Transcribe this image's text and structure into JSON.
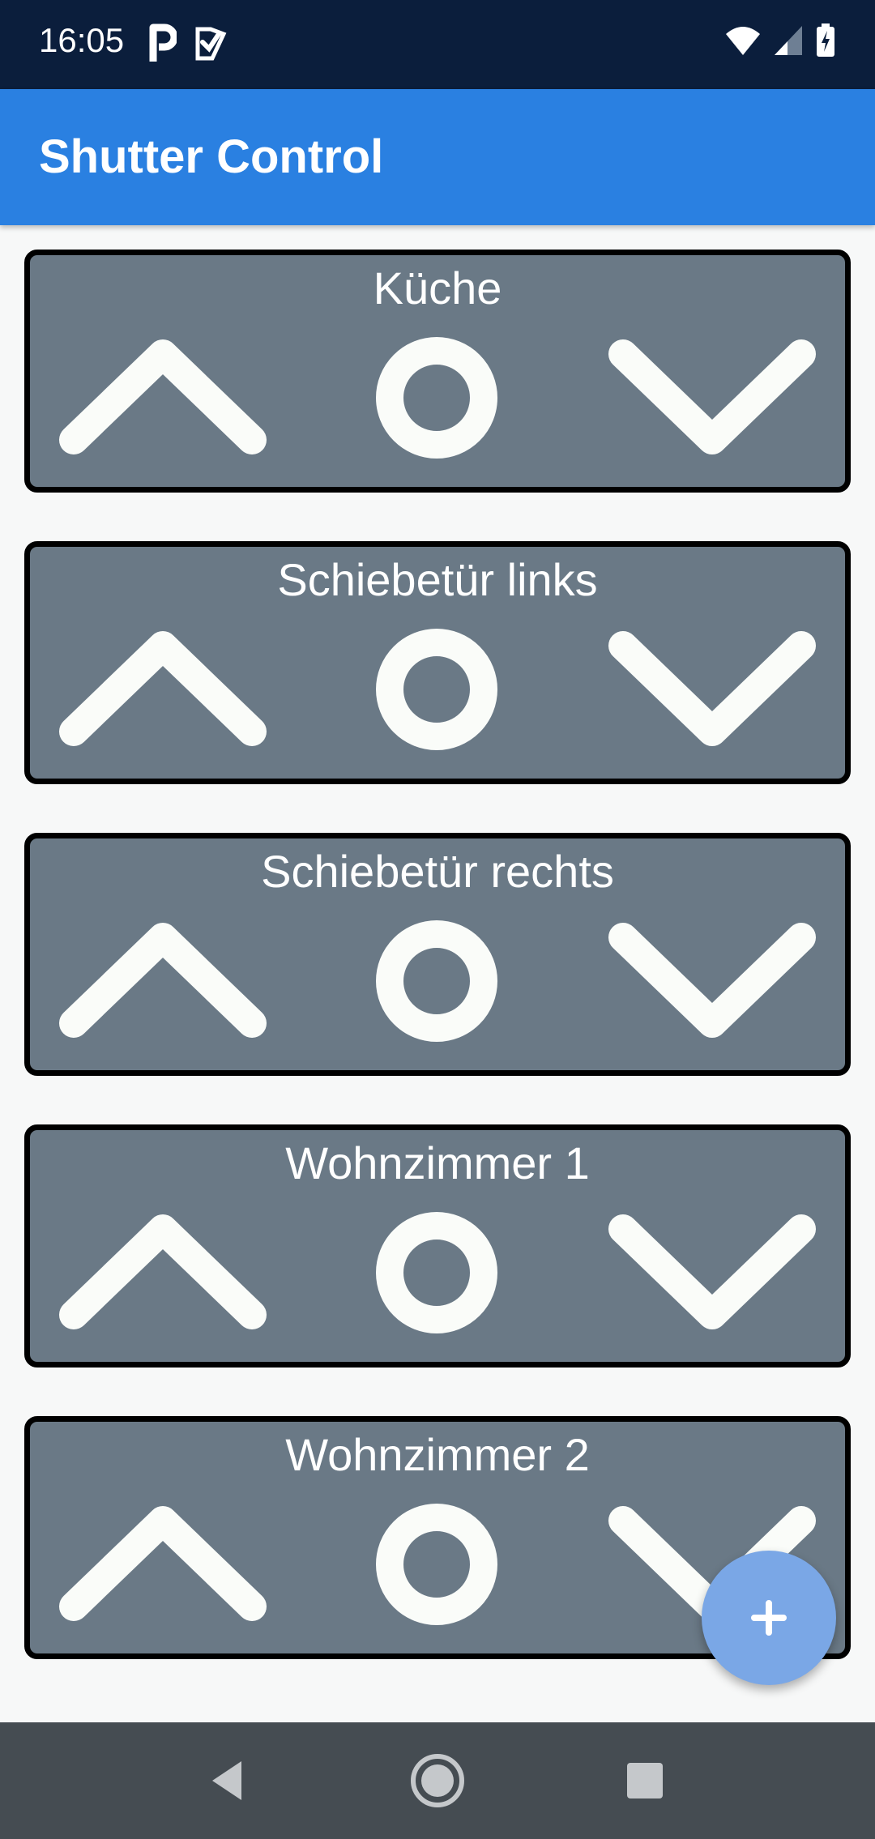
{
  "status_bar": {
    "time": "16:05",
    "left_icons": [
      "p-app-icon",
      "checkmark-app-icon"
    ],
    "right_icons": [
      "wifi-icon",
      "signal-icon",
      "battery-charging-icon"
    ]
  },
  "app_bar": {
    "title": "Shutter Control",
    "color": "#2a80e1"
  },
  "shutters": [
    {
      "name": "Küche"
    },
    {
      "name": "Schiebetür links"
    },
    {
      "name": "Schiebetür rechts"
    },
    {
      "name": "Wohnzimmer 1"
    },
    {
      "name": "Wohnzimmer 2"
    }
  ],
  "controls": {
    "up_icon": "chevron-up-icon",
    "stop_icon": "circle-stop-icon",
    "down_icon": "chevron-down-icon"
  },
  "fab": {
    "icon": "plus-icon",
    "color": "#7aa7e6"
  },
  "nav_bar": {
    "buttons": [
      "back-icon",
      "home-icon",
      "recents-icon"
    ]
  },
  "colors": {
    "card_background": "#6a7986",
    "card_border": "#000000",
    "icon_color": "#fafcf9"
  }
}
